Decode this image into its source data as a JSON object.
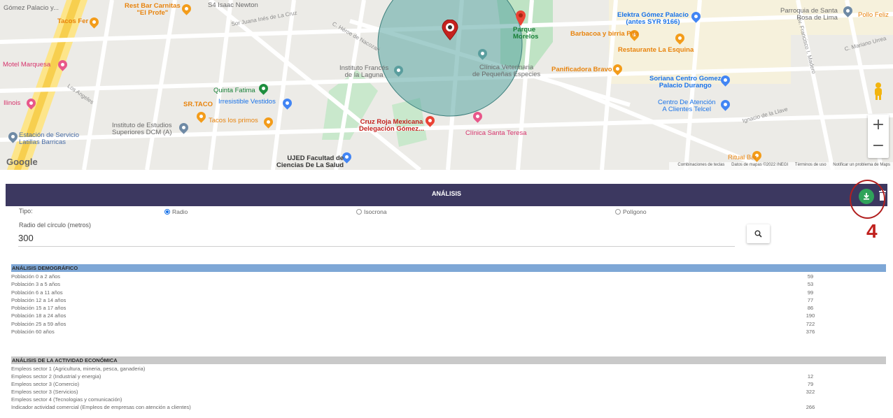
{
  "map": {
    "labels": {
      "gomez_palacio": "Gómez Palacio y...",
      "tacos_fer": "Tacos Fer",
      "rest_bar_carnitas": "Rest Bar Carnitas\n\"El Profe\"",
      "isaac_newton": "S4 Isaac Newton",
      "sor_juana": "Sor Juana Inés de La Cruz",
      "heroe_nacozari": "C. Héroe de Nacozari",
      "parque_morelos": "Parque\nMorelos",
      "elektra": "Elektra Gómez Palacio\n(antes SYR 9166)",
      "barbacoa": "Barbacoa y birria Pilo",
      "restaurante": "Restaurante La Esquina",
      "parroquia": "Parroquia de Santa\nRosa de Lima",
      "pollo_feliz": "Pollo Feliz",
      "mariano_urrea": "C. Mariano Urrea",
      "motel": "Motel Marquesa",
      "instituto_frances": "Instituto Francés\nde la Laguna",
      "clinica_vet": "Clínica Veterinaria\nde Pequeñas Especies",
      "panificadora": "Panificadora Bravo",
      "soriana": "Soriana Centro Gomez\nPalacio Durango",
      "quinta_fatima": "Quinta Fatima",
      "illinois": "Ilinois",
      "sr_taco": "SR.TACO",
      "irresistible": "Irresistible Vestidos",
      "centro_atencion": "Centro De Atención\nA Clientes Telcel",
      "tacos_primos": "Tacos los primos",
      "instituto_estudios": "Instituto de Estudios\nSuperiores DCM (A)",
      "cruz_roja": "Cruz Roja Mexicana\nDelegación Gómez...",
      "clinica_teresa": "Clínica Santa Teresa",
      "estacion": "Estación de Servicio\nLatillas Barricas",
      "ujed": "UJED Facultad de\nCiencias De La Salud",
      "ritual_bar": "Ritual Bar",
      "los_angeles": "Los Angeles",
      "ignacio_llave": "Ignacio de la Llave",
      "madero": "Av. Francisco I. Madero"
    },
    "zoom_in": "+",
    "zoom_out": "−",
    "logo": "Google",
    "footer": {
      "shortcuts": "Combinaciones de teclas",
      "map_data": "Datos de mapas ©2022 INEGI",
      "terms": "Términos de uso",
      "report": "Notificar un problema de Maps"
    }
  },
  "analysis": {
    "title": "ANÁLISIS",
    "tipo_label": "Tipo:",
    "options": [
      "Radio",
      "Isocrona",
      "Polígono"
    ],
    "selected": "Radio",
    "radius_label": "Radio del círculo (metros)",
    "radius_value": "300",
    "annotation_number": "4",
    "accent_color": "#3c3860",
    "download_color": "#2fa35a"
  },
  "demographic": {
    "header": "ANÁLISIS DEMOGRÁFICO",
    "rows": [
      {
        "label": "Población 0 a 2 años",
        "value": "59"
      },
      {
        "label": "Población 3 a 5 años",
        "value": "53"
      },
      {
        "label": "Población 6 a 11 años",
        "value": "99"
      },
      {
        "label": "Población 12 a 14 años",
        "value": "77"
      },
      {
        "label": "Población 15 a 17 años",
        "value": "86"
      },
      {
        "label": "Población 18 a 24 años",
        "value": "190"
      },
      {
        "label": "Población 25 a 59 años",
        "value": "722"
      },
      {
        "label": "Población 60 años",
        "value": "376"
      }
    ]
  },
  "economic": {
    "header": "ANÁLISIS DE LA ACTIVIDAD ECONÓMICA",
    "rows": [
      {
        "label": "Empleos sector 1 (Agricultura, mineria, pesca, ganaderia)",
        "value": ""
      },
      {
        "label": "Empleos sector 2 (Industrial y energia)",
        "value": "12"
      },
      {
        "label": "Empleos sector 3 (Comercio)",
        "value": "79"
      },
      {
        "label": "Empleos sector 3 (Servicios)",
        "value": "322"
      },
      {
        "label": "Empleos sector 4 (Tecnologias y comunicación)",
        "value": ""
      },
      {
        "label": "Indicador actividad comercial (Empleos de empresas con atención a clientes)",
        "value": "266"
      }
    ]
  }
}
